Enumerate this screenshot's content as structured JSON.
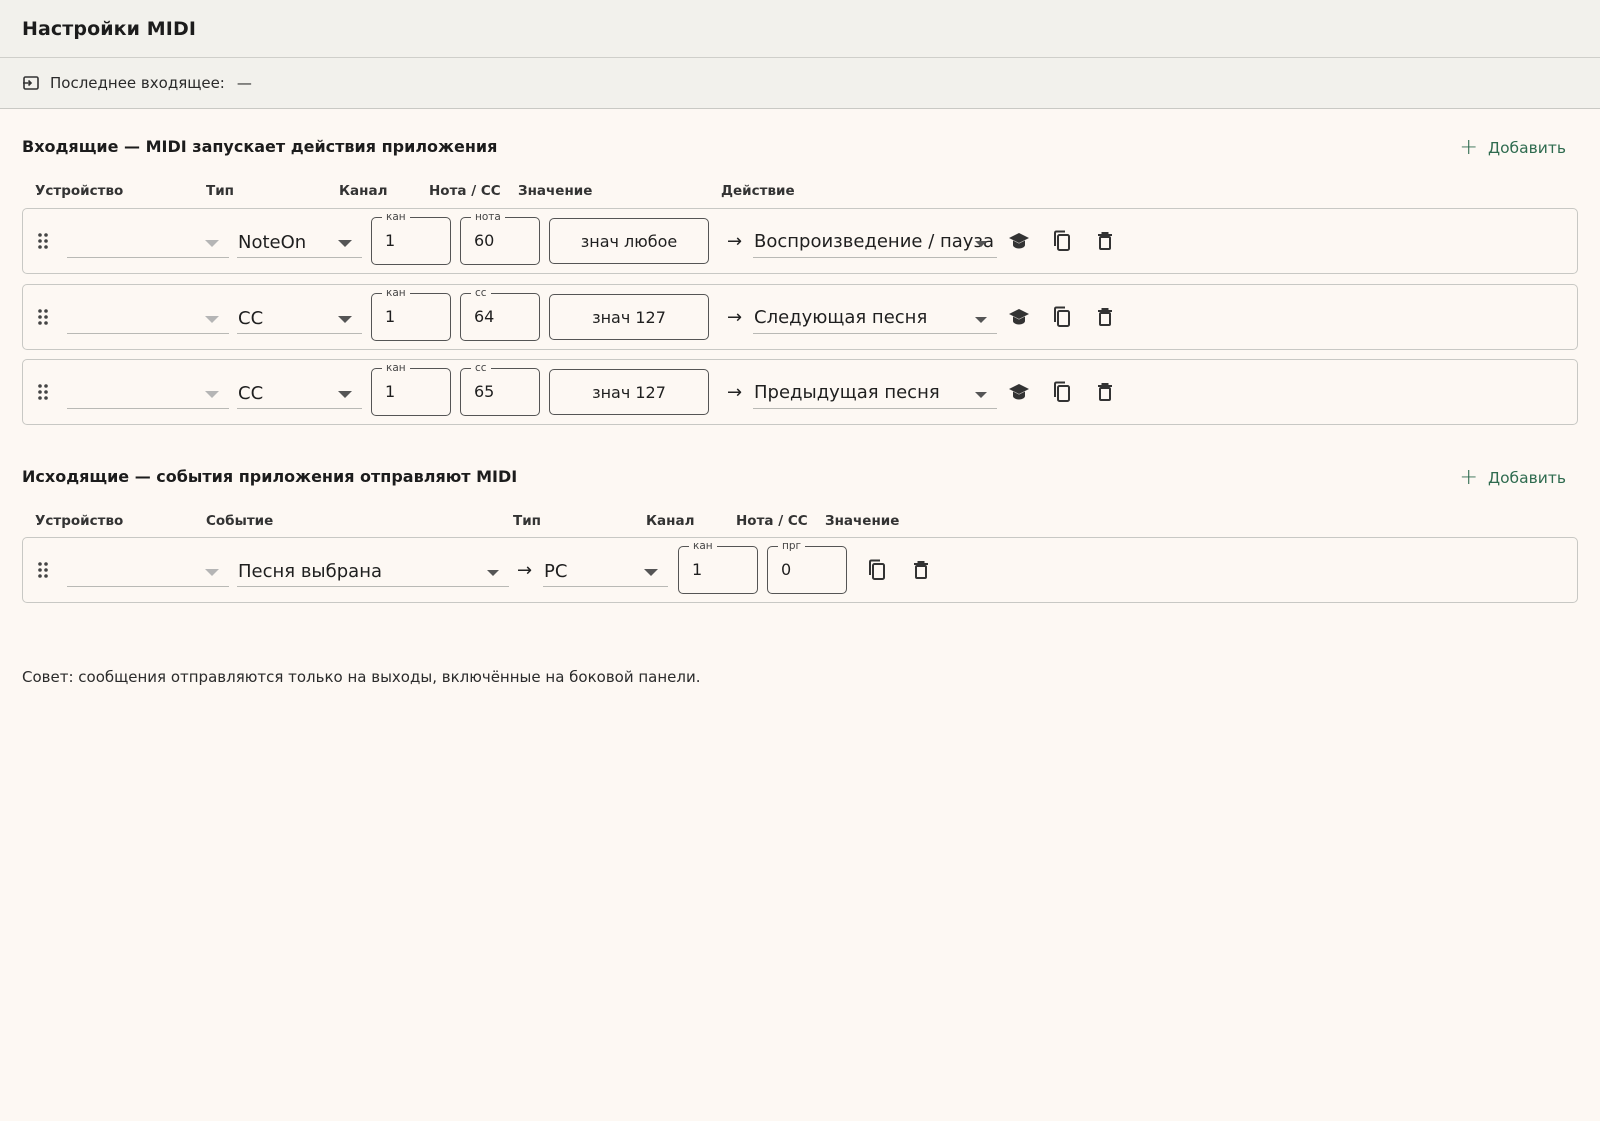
{
  "title": "Настройки MIDI",
  "last_incoming": {
    "label": "Последнее входящее:",
    "value": "—"
  },
  "incoming": {
    "title": "Входящие — MIDI запускает действия приложения",
    "add_label": "Добавить",
    "columns": {
      "device": "Устройство",
      "type": "Тип",
      "channel": "Канал",
      "note_cc": "Нота / CC",
      "value": "Значение",
      "action": "Действие"
    },
    "rows": [
      {
        "device": "",
        "type": "NoteOn",
        "ch_legend": "кан",
        "channel": "1",
        "num_legend": "нота",
        "num": "60",
        "value": "знач любое",
        "action": "Воспроизведение / пауза"
      },
      {
        "device": "",
        "type": "CC",
        "ch_legend": "кан",
        "channel": "1",
        "num_legend": "cc",
        "num": "64",
        "value": "знач 127",
        "action": "Следующая песня"
      },
      {
        "device": "",
        "type": "CC",
        "ch_legend": "кан",
        "channel": "1",
        "num_legend": "cc",
        "num": "65",
        "value": "знач 127",
        "action": "Предыдущая песня"
      }
    ]
  },
  "outgoing": {
    "title": "Исходящие — события приложения отправляют MIDI",
    "add_label": "Добавить",
    "columns": {
      "device": "Устройство",
      "event": "Событие",
      "type": "Тип",
      "channel": "Канал",
      "note_cc": "Нота / CC",
      "value": "Значение"
    },
    "rows": [
      {
        "device": "",
        "event": "Песня выбрана",
        "type": "PC",
        "ch_legend": "кан",
        "channel": "1",
        "num_legend": "прг",
        "num": "0"
      }
    ]
  },
  "tip": "Совет: сообщения отправляются только на выходы, включённые на боковой панели.",
  "icons": {
    "learn": "learn-icon",
    "copy": "copy-icon",
    "delete": "delete-icon",
    "drag": "drag-handle-icon",
    "incoming": "input-icon"
  },
  "colors": {
    "accent": "#2f6b4f",
    "background": "#fdf8f3",
    "header": "#f2f1ec"
  }
}
